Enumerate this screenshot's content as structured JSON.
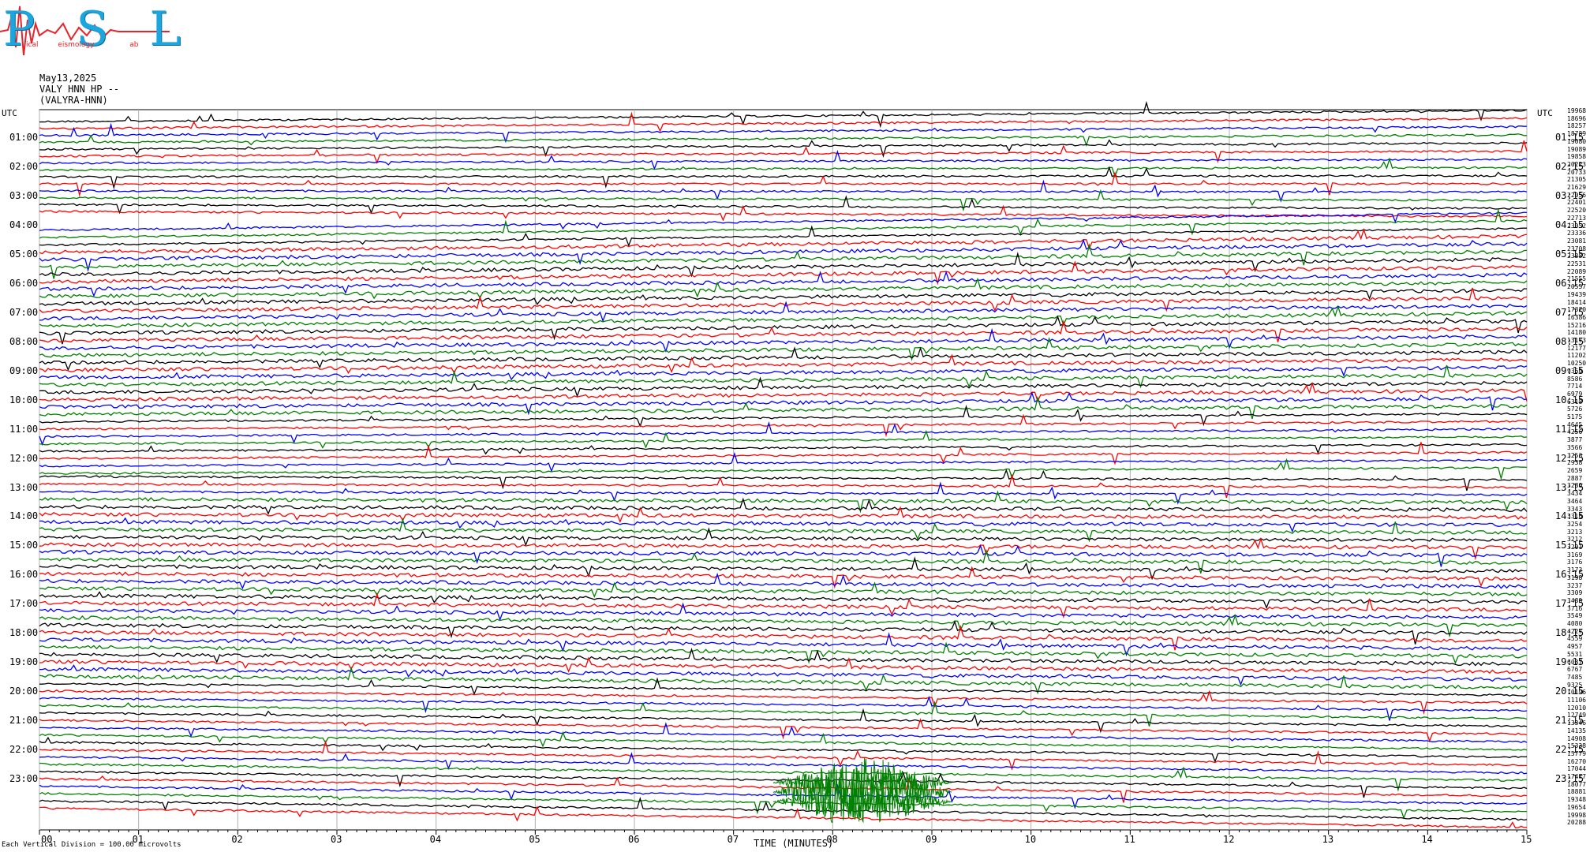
{
  "logo": {
    "letters": "PSL",
    "subtitle_words": [
      "ical",
      "eismology",
      "ab"
    ],
    "colors": {
      "letters": "#1ba6e0",
      "trace": "#e8232a"
    }
  },
  "header": {
    "date": "May13,2025",
    "channel": "VALY HNN HP --",
    "station": "(VALYRA-HNN)"
  },
  "utc_left": "UTC",
  "utc_right": "UTC",
  "chart_data": {
    "type": "line",
    "title": "",
    "xlabel": "TIME (MINUTES)",
    "x_ticks": [
      "00",
      "01",
      "02",
      "03",
      "04",
      "05",
      "06",
      "07",
      "08",
      "09",
      "10",
      "11",
      "12",
      "13",
      "14",
      "15"
    ],
    "xlim": [
      0,
      15
    ],
    "rows_per_hour": 4,
    "row_minutes": 15,
    "trace_colors": [
      "#000000",
      "#ff0000",
      "#0000ff",
      "#008000"
    ],
    "left_hour_labels": [
      "01:00",
      "02:00",
      "03:00",
      "04:00",
      "05:00",
      "06:00",
      "07:00",
      "08:00",
      "09:00",
      "10:00",
      "11:00",
      "12:00",
      "13:00",
      "14:00",
      "15:00",
      "16:00",
      "17:00",
      "18:00",
      "19:00",
      "20:00",
      "21:00",
      "22:00",
      "23:00"
    ],
    "right_hour_labels": [
      "01:15",
      "02:15",
      "03:15",
      "04:15",
      "05:15",
      "06:15",
      "07:15",
      "08:15",
      "09:15",
      "10:15",
      "11:15",
      "12:15",
      "13:15",
      "14:15",
      "15:15",
      "16:15",
      "17:15",
      "18:15",
      "19:15",
      "20:15",
      "21:15",
      "22:15",
      "23:15"
    ],
    "right_row_values": [
      "19968",
      "18696",
      "18257",
      "18789",
      "19080",
      "19089",
      "19858",
      "20223",
      "20733",
      "21305",
      "21629",
      "22056",
      "22401",
      "22520",
      "22713",
      "23052",
      "23336",
      "23081",
      "23708",
      "23382",
      "22531",
      "22089",
      "21555",
      "20557",
      "19439",
      "18414",
      "17370",
      "16386",
      "15216",
      "14180",
      "13173",
      "12177",
      "11202",
      "10250",
      "9360",
      "8586",
      "7714",
      "6979",
      "6318",
      "5726",
      "5175",
      "4645",
      "4256",
      "3877",
      "3566",
      "3253",
      "2938",
      "2659",
      "2887",
      "3280",
      "3434",
      "3464",
      "3343",
      "3316",
      "3254",
      "3213",
      "3212",
      "3201",
      "3169",
      "3176",
      "3173",
      "3198",
      "3237",
      "3309",
      "3489",
      "3716",
      "3549",
      "4080",
      "4227",
      "4559",
      "4957",
      "5531",
      "6087",
      "6767",
      "7485",
      "9325",
      "10196",
      "11106",
      "12010",
      "12749",
      "13346",
      "14135",
      "14908",
      "15338",
      "15779",
      "16270",
      "17044",
      "17477",
      "18077",
      "18881",
      "19348",
      "19654",
      "19998",
      "20288"
    ],
    "vertical_scale": "Each Vertical Division =  100.00 microvolts",
    "grid": true
  }
}
